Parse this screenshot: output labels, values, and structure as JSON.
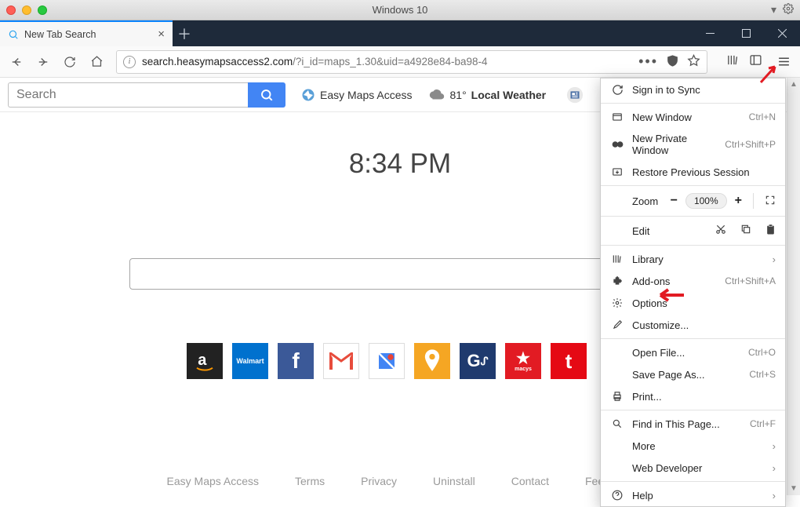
{
  "window": {
    "title": "Windows 10"
  },
  "tab": {
    "title": "New Tab Search"
  },
  "url": {
    "host": "search.heasymapsaccess2.com",
    "path": "/?i_id=maps_1.30&uid=a4928e84-ba98-4"
  },
  "page": {
    "search_placeholder": "Search",
    "toolbar": {
      "maps": "Easy Maps Access",
      "temp": "81°",
      "weather_label": "Local Weather"
    },
    "clock": "8:34 PM",
    "footer": [
      "Easy Maps Access",
      "Terms",
      "Privacy",
      "Uninstall",
      "Contact",
      "Feedback"
    ]
  },
  "menu": {
    "sign_in": "Sign in to Sync",
    "new_window": {
      "label": "New Window",
      "shortcut": "Ctrl+N"
    },
    "new_private": {
      "label": "New Private Window",
      "shortcut": "Ctrl+Shift+P"
    },
    "restore": "Restore Previous Session",
    "zoom": {
      "label": "Zoom",
      "value": "100%"
    },
    "edit": "Edit",
    "library": "Library",
    "addons": {
      "label": "Add-ons",
      "shortcut": "Ctrl+Shift+A"
    },
    "options": "Options",
    "customize": "Customize...",
    "open_file": {
      "label": "Open File...",
      "shortcut": "Ctrl+O"
    },
    "save_as": {
      "label": "Save Page As...",
      "shortcut": "Ctrl+S"
    },
    "print": "Print...",
    "find": {
      "label": "Find in This Page...",
      "shortcut": "Ctrl+F"
    },
    "more": "More",
    "web_dev": "Web Developer",
    "help": "Help"
  }
}
